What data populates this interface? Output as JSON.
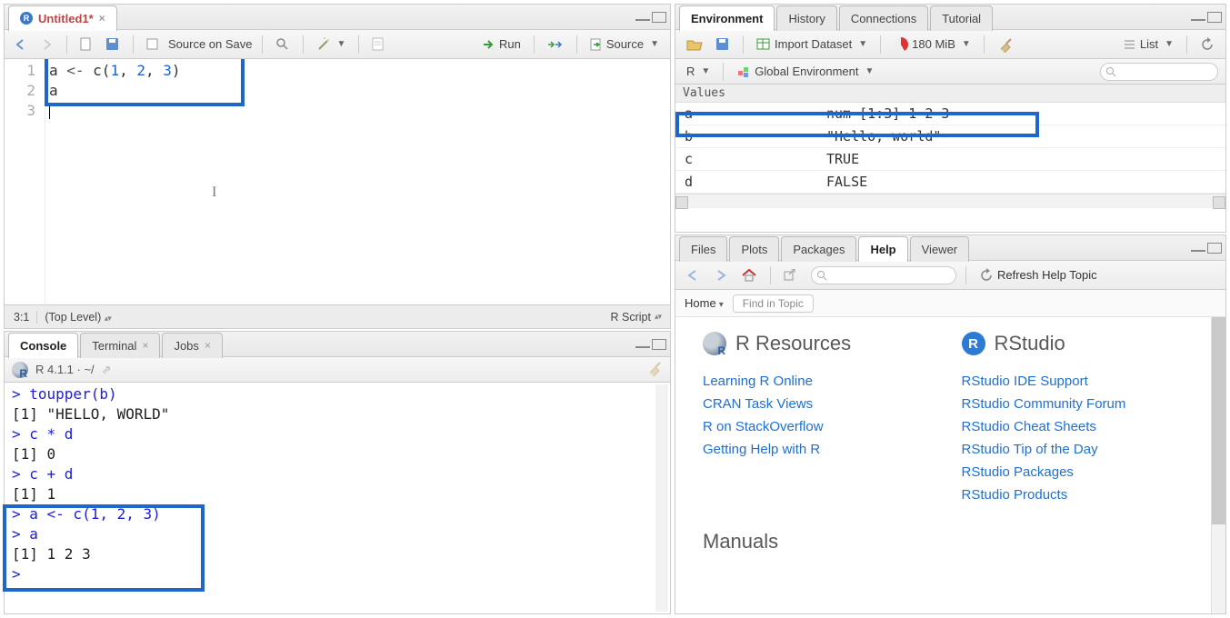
{
  "source_pane": {
    "tab_title": "Untitled1*",
    "save_on_source": "Source on Save",
    "run": "Run",
    "source_btn": "Source",
    "code_lines": 3,
    "code_line1_a": "a ",
    "code_line1_b": "<-",
    "code_line1_c": " c",
    "code_line1_d": "(",
    "code_line1_e": "1",
    "code_line1_f": ", ",
    "code_line1_g": "2",
    "code_line1_h": ", ",
    "code_line1_i": "3",
    "code_line1_j": ")",
    "code_line2": "a",
    "status_pos": "3:1",
    "status_scope": "(Top Level)",
    "status_type": "R Script"
  },
  "console_pane": {
    "tabs": {
      "console": "Console",
      "terminal": "Terminal",
      "jobs": "Jobs"
    },
    "info": "R 4.1.1 · ~/",
    "lines": {
      "l1": "> toupper(b)",
      "l2": "[1] \"HELLO, WORLD\"",
      "l3": "> c * d",
      "l4": "[1] 0",
      "l5": "> c + d",
      "l6": "[1] 1",
      "l7": "> a <- c(1, 2, 3)",
      "l8": "> a",
      "l9": "[1] 1 2 3",
      "l10": "> "
    }
  },
  "env_pane": {
    "tabs": {
      "env": "Environment",
      "hist": "History",
      "conn": "Connections",
      "tut": "Tutorial"
    },
    "import": "Import Dataset",
    "mem": "180 MiB",
    "view": "List",
    "scope_lang": "R",
    "scope": "Global Environment",
    "section": "Values",
    "rows": [
      {
        "k": "a",
        "v": "num [1:3] 1 2 3"
      },
      {
        "k": "b",
        "v": "\"Hello, world\""
      },
      {
        "k": "c",
        "v": "TRUE"
      },
      {
        "k": "d",
        "v": "FALSE"
      }
    ]
  },
  "help_pane": {
    "tabs": {
      "files": "Files",
      "plots": "Plots",
      "pkg": "Packages",
      "help": "Help",
      "viewer": "Viewer"
    },
    "refresh": "Refresh Help Topic",
    "home": "Home",
    "find": "Find in Topic",
    "h_r": "R Resources",
    "h_rs": "RStudio",
    "links_left": [
      "Learning R Online",
      "CRAN Task Views",
      "R on StackOverflow",
      "Getting Help with R"
    ],
    "links_right": [
      "RStudio IDE Support",
      "RStudio Community Forum",
      "RStudio Cheat Sheets",
      "RStudio Tip of the Day",
      "RStudio Packages",
      "RStudio Products"
    ],
    "manuals": "Manuals"
  }
}
